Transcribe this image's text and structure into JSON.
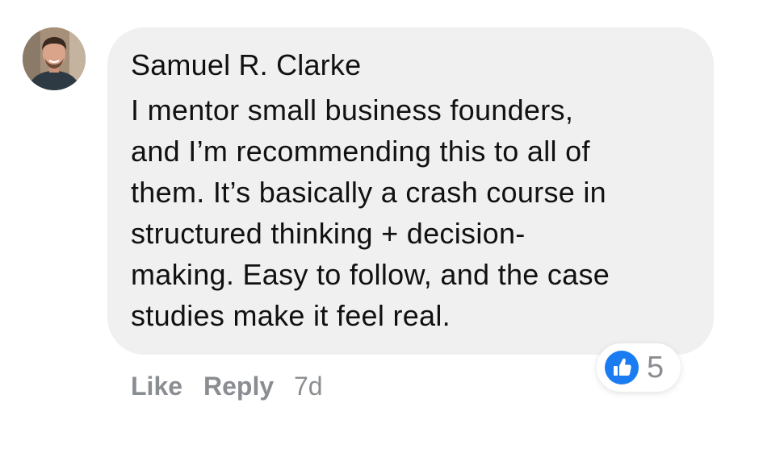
{
  "comment": {
    "author": "Samuel R. Clarke",
    "lines": [
      "I mentor small business founders,",
      "and I’m recommending this to all of",
      "them. It’s basically a crash course in",
      "structured thinking + decision-",
      "making. Easy to follow, and the case",
      "studies make it feel real."
    ],
    "reactions": {
      "icon": "thumbs-up-icon",
      "color": "#1b7cf2",
      "count": "5"
    },
    "actions": {
      "like_label": "Like",
      "reply_label": "Reply",
      "timestamp": "7d"
    }
  }
}
